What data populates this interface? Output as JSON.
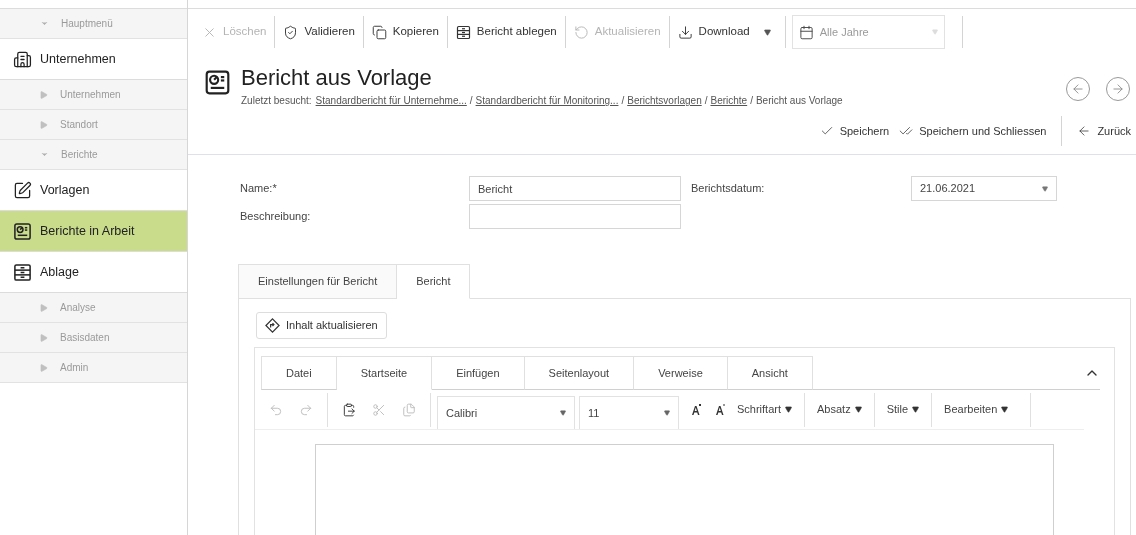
{
  "sidebar": {
    "items": [
      {
        "kind": "group",
        "label": "Hauptmenü",
        "expanded": true,
        "selected": false
      },
      {
        "kind": "module",
        "label": "Unternehmen",
        "selected": false
      },
      {
        "kind": "group",
        "label": "Unternehmen",
        "expanded": false,
        "selected": false
      },
      {
        "kind": "group",
        "label": "Standort",
        "expanded": false,
        "selected": false
      },
      {
        "kind": "group",
        "label": "Berichte",
        "expanded": true,
        "selected": false
      },
      {
        "kind": "module",
        "label": "Vorlagen",
        "selected": false
      },
      {
        "kind": "module",
        "label": "Berichte in Arbeit",
        "selected": true
      },
      {
        "kind": "module",
        "label": "Ablage",
        "selected": false
      },
      {
        "kind": "group",
        "label": "Analyse",
        "expanded": false,
        "selected": false
      },
      {
        "kind": "group",
        "label": "Basisdaten",
        "expanded": false,
        "selected": false
      },
      {
        "kind": "group",
        "label": "Admin",
        "expanded": false,
        "selected": false
      }
    ]
  },
  "toolbar": {
    "items": [
      {
        "kind": "button",
        "label": "Löschen",
        "disabled": true
      },
      {
        "kind": "button",
        "label": "Validieren",
        "disabled": false
      },
      {
        "kind": "button",
        "label": "Kopieren",
        "disabled": false
      },
      {
        "kind": "button",
        "label": "Bericht ablegen",
        "disabled": false
      },
      {
        "kind": "button",
        "label": "Aktualisieren",
        "disabled": true
      },
      {
        "kind": "menu",
        "label": "Download",
        "disabled": false
      }
    ],
    "year_select": {
      "value": "Alle Jahre",
      "disabled": true
    }
  },
  "page": {
    "title": "Bericht aus Vorlage",
    "breadcrumb": {
      "label": "Zuletzt besucht:",
      "separator": "/",
      "items": [
        {
          "kind": "link",
          "text": "Standardbericht für Unternehme..."
        },
        {
          "kind": "link",
          "text": "Standardbericht für Monitoring..."
        },
        {
          "kind": "link",
          "text": "Berichtsvorlagen"
        },
        {
          "kind": "link",
          "text": "Berichte"
        },
        {
          "kind": "current",
          "text": "Bericht aus Vorlage"
        }
      ]
    },
    "actions": [
      "Speichern",
      "Speichern und Schliessen",
      "Zurück"
    ]
  },
  "form": {
    "name_label": "Name:*",
    "name_value": "Bericht",
    "description_label": "Beschreibung:",
    "date_label": "Berichtsdatum:",
    "date_value": "21.06.2021"
  },
  "tabs": [
    {
      "label": "Einstellungen für Bericht",
      "selected": false
    },
    {
      "label": "Bericht",
      "selected": true
    }
  ],
  "refresh_button": "Inhalt aktualisieren",
  "editor": {
    "ribbon_tabs": [
      {
        "label": "Datei",
        "selected": false
      },
      {
        "label": "Startseite",
        "selected": true
      },
      {
        "label": "Einfügen",
        "selected": false
      },
      {
        "label": "Seitenlayout",
        "selected": false
      },
      {
        "label": "Verweise",
        "selected": false
      },
      {
        "label": "Ansicht",
        "selected": false
      }
    ],
    "tools": [
      {
        "kind": "undo",
        "disabled": true
      },
      {
        "kind": "redo",
        "disabled": true
      },
      {
        "kind": "paste",
        "disabled": false
      },
      {
        "kind": "cut",
        "disabled": true
      },
      {
        "kind": "copy",
        "disabled": true
      }
    ],
    "font": "Calibri",
    "size": "11",
    "menus": [
      "Schriftart",
      "Absatz",
      "Stile",
      "Bearbeiten"
    ]
  }
}
